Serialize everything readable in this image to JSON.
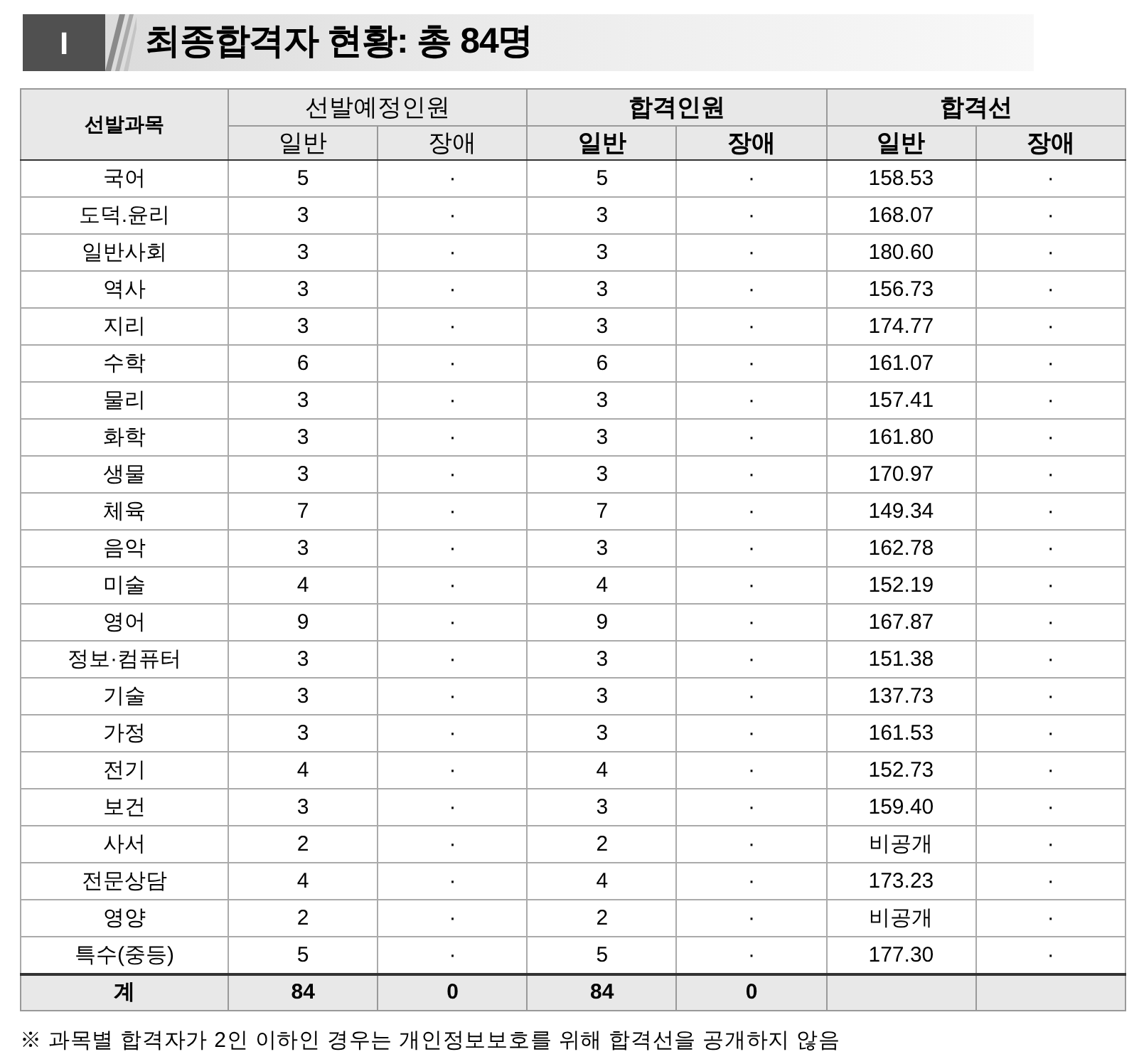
{
  "section": {
    "number": "I",
    "title": "최종합격자 현황: 총 84명"
  },
  "table": {
    "first_column": "선발과목",
    "groups": [
      {
        "label": "선발예정인원",
        "bold": false,
        "columns": [
          "일반",
          "장애"
        ]
      },
      {
        "label": "합격인원",
        "bold": true,
        "columns": [
          "일반",
          "장애"
        ]
      },
      {
        "label": "합격선",
        "bold": true,
        "columns": [
          "일반",
          "장애"
        ]
      }
    ],
    "rows": [
      [
        "국어",
        "5",
        "·",
        "5",
        "·",
        "158.53",
        "·"
      ],
      [
        "도덕.윤리",
        "3",
        "·",
        "3",
        "·",
        "168.07",
        "·"
      ],
      [
        "일반사회",
        "3",
        "·",
        "3",
        "·",
        "180.60",
        "·"
      ],
      [
        "역사",
        "3",
        "·",
        "3",
        "·",
        "156.73",
        "·"
      ],
      [
        "지리",
        "3",
        "·",
        "3",
        "·",
        "174.77",
        "·"
      ],
      [
        "수학",
        "6",
        "·",
        "6",
        "·",
        "161.07",
        "·"
      ],
      [
        "물리",
        "3",
        "·",
        "3",
        "·",
        "157.41",
        "·"
      ],
      [
        "화학",
        "3",
        "·",
        "3",
        "·",
        "161.80",
        "·"
      ],
      [
        "생물",
        "3",
        "·",
        "3",
        "·",
        "170.97",
        "·"
      ],
      [
        "체육",
        "7",
        "·",
        "7",
        "·",
        "149.34",
        "·"
      ],
      [
        "음악",
        "3",
        "·",
        "3",
        "·",
        "162.78",
        "·"
      ],
      [
        "미술",
        "4",
        "·",
        "4",
        "·",
        "152.19",
        "·"
      ],
      [
        "영어",
        "9",
        "·",
        "9",
        "·",
        "167.87",
        "·"
      ],
      [
        "정보·컴퓨터",
        "3",
        "·",
        "3",
        "·",
        "151.38",
        "·"
      ],
      [
        "기술",
        "3",
        "·",
        "3",
        "·",
        "137.73",
        "·"
      ],
      [
        "가정",
        "3",
        "·",
        "3",
        "·",
        "161.53",
        "·"
      ],
      [
        "전기",
        "4",
        "·",
        "4",
        "·",
        "152.73",
        "·"
      ],
      [
        "보건",
        "3",
        "·",
        "3",
        "·",
        "159.40",
        "·"
      ],
      [
        "사서",
        "2",
        "·",
        "2",
        "·",
        "비공개",
        "·"
      ],
      [
        "전문상담",
        "4",
        "·",
        "4",
        "·",
        "173.23",
        "·"
      ],
      [
        "영양",
        "2",
        "·",
        "2",
        "·",
        "비공개",
        "·"
      ],
      [
        "특수(중등)",
        "5",
        "·",
        "5",
        "·",
        "177.30",
        "·"
      ]
    ],
    "total": [
      "계",
      "84",
      "0",
      "84",
      "0"
    ]
  },
  "footnote": "※ 과목별 합격자가 2인 이하인 경우는 개인정보보호를 위해 합격선을 공개하지 않음"
}
